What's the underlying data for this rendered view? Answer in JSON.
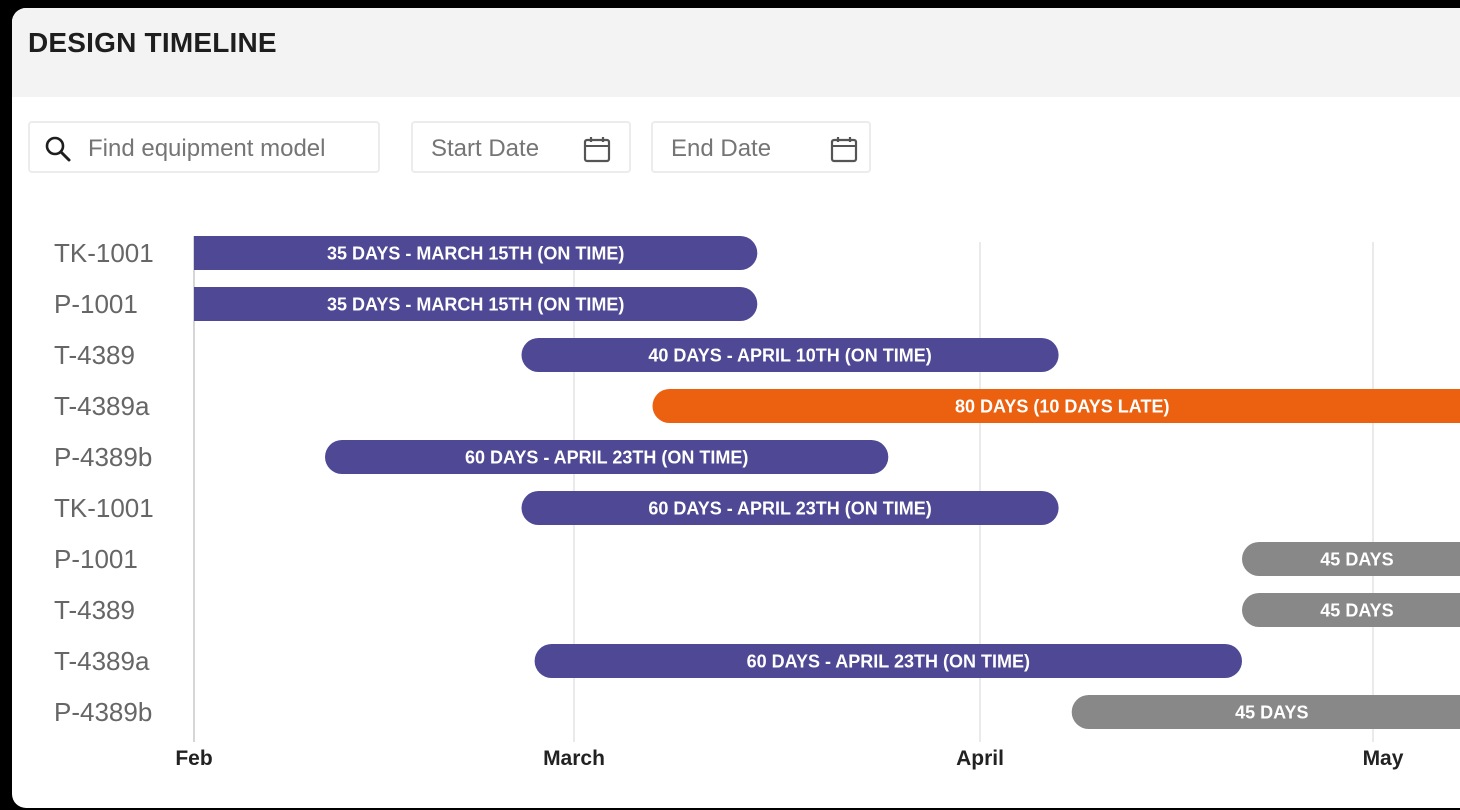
{
  "header": {
    "title": "DESIGN TIMELINE"
  },
  "filters": {
    "search_placeholder": "Find equipment model",
    "start_date_placeholder": "Start Date",
    "end_date_placeholder": "End Date"
  },
  "colors": {
    "on_time": "#4e4895",
    "late": "#ec610f",
    "planned": "#888888"
  },
  "chart_data": {
    "type": "gantt",
    "x_axis": {
      "ticks": [
        "Feb",
        "March",
        "April",
        "May"
      ],
      "range": [
        "2024-02-01",
        "2024-05-18"
      ]
    },
    "rows": [
      {
        "label": "TK-1001",
        "start": "2024-02-01",
        "end": "2024-03-15",
        "bar_label": "35 DAYS - MARCH 15TH (ON TIME)",
        "status": "on_time"
      },
      {
        "label": "P-1001",
        "start": "2024-02-01",
        "end": "2024-03-15",
        "bar_label": "35 DAYS - MARCH 15TH (ON TIME)",
        "status": "on_time"
      },
      {
        "label": "T-4389",
        "start": "2024-02-26",
        "end": "2024-04-07",
        "bar_label": "40 DAYS - APRIL 10TH (ON TIME)",
        "status": "on_time"
      },
      {
        "label": "T-4389a",
        "start": "2024-03-07",
        "end": "2024-05-26",
        "bar_label": "80 DAYS (10 DAYS LATE)",
        "status": "late"
      },
      {
        "label": "P-4389b",
        "start": "2024-02-11",
        "end": "2024-03-25",
        "bar_label": "60 DAYS - APRIL 23TH (ON TIME)",
        "status": "on_time"
      },
      {
        "label": "TK-1001",
        "start": "2024-02-26",
        "end": "2024-04-07",
        "bar_label": "60 DAYS - APRIL 23TH (ON TIME)",
        "status": "on_time"
      },
      {
        "label": "P-1001",
        "start": "2024-04-21",
        "end": "2024-06-04",
        "bar_label": "45 DAYS",
        "status": "planned"
      },
      {
        "label": "T-4389",
        "start": "2024-04-21",
        "end": "2024-06-04",
        "bar_label": "45 DAYS",
        "status": "planned"
      },
      {
        "label": "T-4389a",
        "start": "2024-02-27",
        "end": "2024-04-21",
        "bar_label": "60 DAYS - APRIL 23TH (ON TIME)",
        "status": "on_time"
      },
      {
        "label": "P-4389b",
        "start": "2024-04-08",
        "end": "2024-05-26",
        "bar_label": "45 DAYS",
        "status": "planned"
      }
    ]
  }
}
